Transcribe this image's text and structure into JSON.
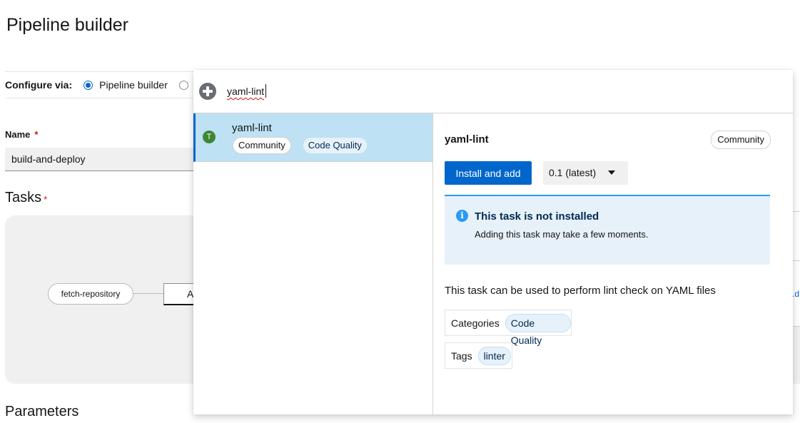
{
  "page": {
    "title": "Pipeline builder",
    "configure_via_label": "Configure via:",
    "configure_options": [
      "Pipeline builder",
      ""
    ],
    "name_label": "Name",
    "name_required": "*",
    "name_value": "build-and-deploy",
    "tasks_title": "Tasks",
    "tasks_required": "*",
    "task_node_1": "fetch-repository",
    "task_node_2_partial": "A",
    "parameters_title": "Parameters",
    "right_edge_link_fragment": ".d"
  },
  "quick_search": {
    "query": "yaml-lint",
    "results": [
      {
        "title": "yaml-lint",
        "avatar_letter": "T",
        "chips": [
          "Community",
          "Code Quality"
        ],
        "selected": true
      }
    ],
    "detail": {
      "title": "yaml-lint",
      "badge": "Community",
      "install_button": "Install and add",
      "version": "0.1 (latest)",
      "alert": {
        "title": "This task is not installed",
        "body": "Adding this task may take a few moments."
      },
      "description": "This task can be used to perform lint check on YAML files",
      "categories_label": "Categories",
      "categories": [
        "Code Quality"
      ],
      "tags_label": "Tags",
      "tags": [
        "linter"
      ]
    }
  },
  "colors": {
    "primary": "#0066cc",
    "selected_bg": "#bee1f4",
    "info_bg": "#e7f1fa",
    "info_accent": "#2b9af3",
    "task_avatar": "#3e8635",
    "required": "#c9190b"
  },
  "icons": {
    "search_add": "plus-circle-icon",
    "alert": "info-circle-icon",
    "select_toggle": "caret-down-icon"
  }
}
